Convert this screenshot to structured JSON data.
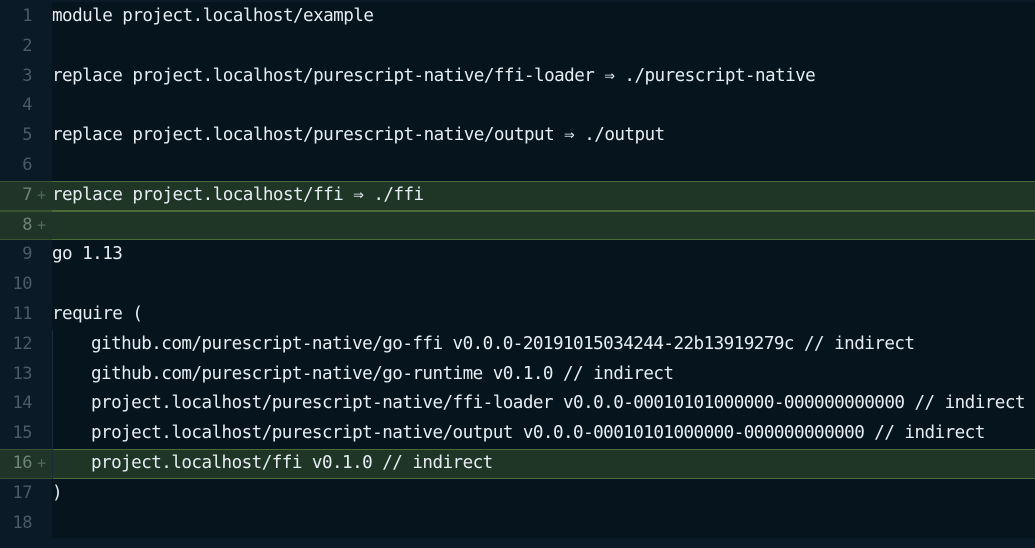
{
  "editor": {
    "lines": [
      {
        "num": "1",
        "text": "module project.localhost/example",
        "added": false,
        "indented": false
      },
      {
        "num": "2",
        "text": "",
        "added": false,
        "indented": false
      },
      {
        "num": "3",
        "text": "replace project.localhost/purescript-native/ffi-loader ⇒ ./purescript-native",
        "added": false,
        "indented": false
      },
      {
        "num": "4",
        "text": "",
        "added": false,
        "indented": false
      },
      {
        "num": "5",
        "text": "replace project.localhost/purescript-native/output ⇒ ./output",
        "added": false,
        "indented": false
      },
      {
        "num": "6",
        "text": "",
        "added": false,
        "indented": false
      },
      {
        "num": "7",
        "text": "replace project.localhost/ffi ⇒ ./ffi",
        "added": true,
        "indented": false
      },
      {
        "num": "8",
        "text": "",
        "added": true,
        "indented": false
      },
      {
        "num": "9",
        "text": "go 1.13",
        "added": false,
        "indented": false
      },
      {
        "num": "10",
        "text": "",
        "added": false,
        "indented": false
      },
      {
        "num": "11",
        "text": "require (",
        "added": false,
        "indented": false
      },
      {
        "num": "12",
        "text": "github.com/purescript-native/go-ffi v0.0.0-20191015034244-22b13919279c // indirect",
        "added": false,
        "indented": true
      },
      {
        "num": "13",
        "text": "github.com/purescript-native/go-runtime v0.1.0 // indirect",
        "added": false,
        "indented": true
      },
      {
        "num": "14",
        "text": "project.localhost/purescript-native/ffi-loader v0.0.0-00010101000000-000000000000 // indirect",
        "added": false,
        "indented": true
      },
      {
        "num": "15",
        "text": "project.localhost/purescript-native/output v0.0.0-00010101000000-000000000000 // indirect",
        "added": false,
        "indented": true
      },
      {
        "num": "16",
        "text": "project.localhost/ffi v0.1.0 // indirect",
        "added": true,
        "indented": true
      },
      {
        "num": "17",
        "text": ")",
        "added": false,
        "indented": false
      },
      {
        "num": "18",
        "text": "",
        "added": false,
        "indented": false
      }
    ],
    "added_marker": "+"
  },
  "colors": {
    "background": "#0a1a26",
    "code_background": "#06141e",
    "added_background": "#1f3526",
    "added_border": "#4a6b3a",
    "line_number": "#4a5b66",
    "text": "#e6edf2"
  }
}
